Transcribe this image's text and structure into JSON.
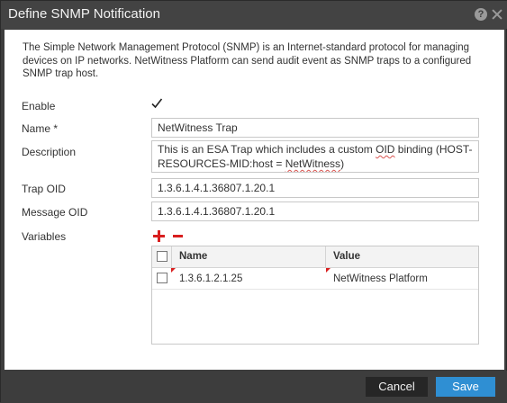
{
  "dialog": {
    "title": "Define SNMP Notification",
    "help_icon": "help-icon",
    "close_icon": "close-icon"
  },
  "intro_text": "The Simple Network Management Protocol (SNMP) is an Internet-standard protocol for managing devices on IP networks. NetWitness Platform can send audit event as SNMP traps to a configured SNMP trap host.",
  "form": {
    "enable_label": "Enable",
    "enable_checked": true,
    "name_label": "Name *",
    "name_value": "NetWitness Trap",
    "description_label": "Description",
    "description_value_part1": "This is an ESA Trap which includes a custom ",
    "description_value_squiggle1": "OID",
    "description_value_part2": " binding (HOST-RESOURCES-MID:host = ",
    "description_value_squiggle2": "NetWitness",
    "description_value_part3": ")",
    "trap_oid_label": "Trap OID",
    "trap_oid_value": "1.3.6.1.4.1.36807.1.20.1",
    "message_oid_label": "Message OID",
    "message_oid_value": "1.3.6.1.4.1.36807.1.20.1",
    "variables_label": "Variables"
  },
  "variables_table": {
    "columns": [
      "Name",
      "Value"
    ],
    "rows": [
      {
        "name": "1.3.6.1.2.1.25",
        "value": "NetWitness Platform",
        "checked": false
      }
    ]
  },
  "footer": {
    "cancel_label": "Cancel",
    "save_label": "Save"
  },
  "colors": {
    "accent": "#2f8fd3",
    "danger": "#d81e1e",
    "title_bar": "#434343"
  }
}
